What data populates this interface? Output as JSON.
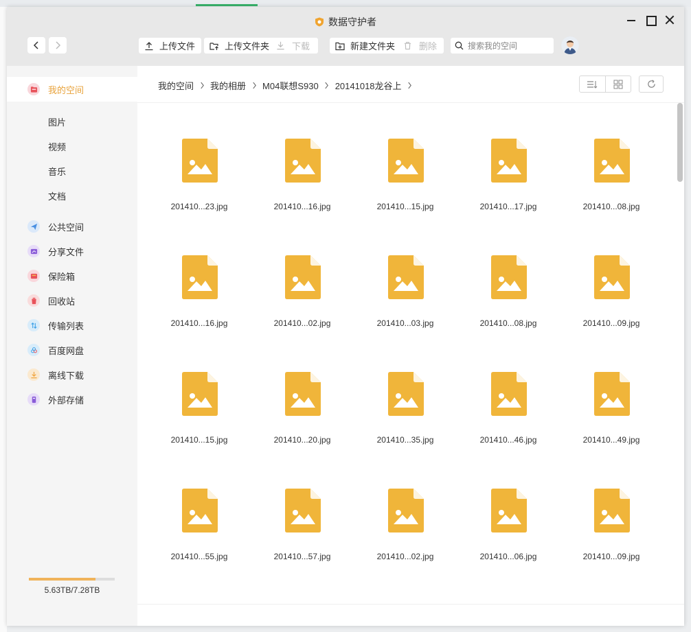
{
  "window": {
    "title": "数据守护者"
  },
  "toolbar": {
    "upload_file": "上传文件",
    "upload_folder": "上传文件夹",
    "download": "下载",
    "new_folder": "新建文件夹",
    "delete": "删除",
    "search_placeholder": "搜索我的空间"
  },
  "sidebar": {
    "my_space": "我的空间",
    "sub": [
      "图片",
      "视频",
      "音乐",
      "文档"
    ],
    "items": [
      {
        "label": "公共空间",
        "icon": "send-icon",
        "color": "#4a90e2"
      },
      {
        "label": "分享文件",
        "icon": "share-icon",
        "color": "#8a5cd8"
      },
      {
        "label": "保险箱",
        "icon": "safe-icon",
        "color": "#e8525a"
      },
      {
        "label": "回收站",
        "icon": "trash-icon",
        "color": "#e8525a"
      },
      {
        "label": "传输列表",
        "icon": "transfer-icon",
        "color": "#3fa2e8"
      },
      {
        "label": "百度网盘",
        "icon": "baidu-cloud-icon",
        "color": "#3fa2e8"
      },
      {
        "label": "离线下载",
        "icon": "offline-download-icon",
        "color": "#f0a640"
      },
      {
        "label": "外部存储",
        "icon": "external-storage-icon",
        "color": "#8a5cd8"
      }
    ],
    "storage": {
      "used_fraction": 0.773,
      "text": "5.63TB/7.28TB"
    }
  },
  "breadcrumb": [
    "我的空间",
    "我的相册",
    "M04联想S930",
    "20141018龙谷上"
  ],
  "files": [
    "201410...23.jpg",
    "201410...16.jpg",
    "201410...15.jpg",
    "201410...17.jpg",
    "201410...08.jpg",
    "201410...16.jpg",
    "201410...02.jpg",
    "201410...03.jpg",
    "201410...08.jpg",
    "201410...09.jpg",
    "201410...15.jpg",
    "201410...20.jpg",
    "201410...35.jpg",
    "201410...46.jpg",
    "201410...49.jpg",
    "201410...55.jpg",
    "201410...57.jpg",
    "201410...02.jpg",
    "201410...06.jpg",
    "201410...09.jpg"
  ],
  "colors": {
    "accent": "#e8a23a",
    "file_icon": "#f0b53a"
  }
}
